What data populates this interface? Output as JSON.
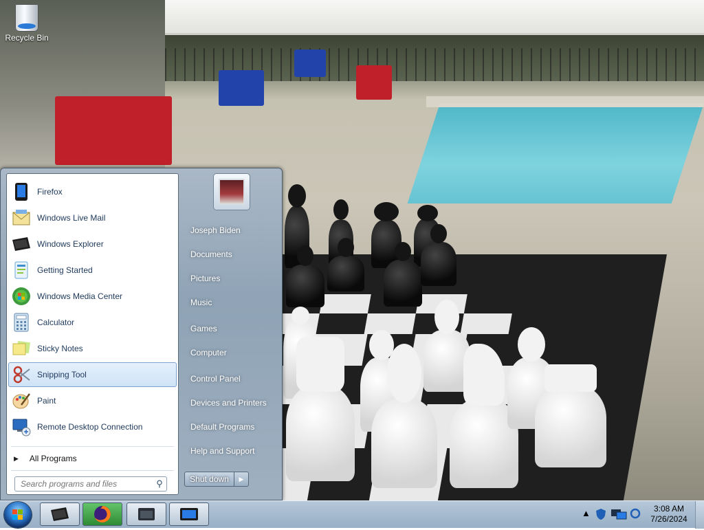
{
  "desktop": {
    "icons": [
      {
        "label": "Recycle Bin",
        "icon": "recycle-bin-icon"
      }
    ]
  },
  "start_menu": {
    "programs": [
      {
        "label": "Firefox",
        "icon": "firefox-icon",
        "selected": false
      },
      {
        "label": "Windows Live Mail",
        "icon": "windows-live-mail-icon",
        "selected": false
      },
      {
        "label": "Windows Explorer",
        "icon": "windows-explorer-icon",
        "selected": false
      },
      {
        "label": "Getting Started",
        "icon": "getting-started-icon",
        "selected": false
      },
      {
        "label": "Windows Media Center",
        "icon": "windows-media-center-icon",
        "selected": false
      },
      {
        "label": "Calculator",
        "icon": "calculator-icon",
        "selected": false
      },
      {
        "label": "Sticky Notes",
        "icon": "sticky-notes-icon",
        "selected": false
      },
      {
        "label": "Snipping Tool",
        "icon": "snipping-tool-icon",
        "selected": true
      },
      {
        "label": "Paint",
        "icon": "paint-icon",
        "selected": false
      },
      {
        "label": "Remote Desktop Connection",
        "icon": "remote-desktop-icon",
        "selected": false
      }
    ],
    "all_programs": "All Programs",
    "search_placeholder": "Search programs and files",
    "user_name": "Joseph Biden",
    "links": [
      "Documents",
      "Pictures",
      "Music",
      "Games",
      "Computer",
      "Control Panel",
      "Devices and Printers",
      "Default Programs",
      "Help and Support"
    ],
    "shutdown_label": "Shut down"
  },
  "taskbar": {
    "pinned": [
      {
        "name": "explorer",
        "icon": "windows-explorer-icon"
      },
      {
        "name": "firefox",
        "icon": "firefox-icon"
      },
      {
        "name": "window",
        "icon": "window-icon"
      },
      {
        "name": "screen",
        "icon": "monitor-icon"
      }
    ],
    "clock": {
      "time": "3:08 AM",
      "date": "7/26/2024"
    }
  },
  "colors": {
    "taskbar": "#a6bbcf",
    "selection": "#cfe3f7",
    "program_text": "#1e395b"
  }
}
